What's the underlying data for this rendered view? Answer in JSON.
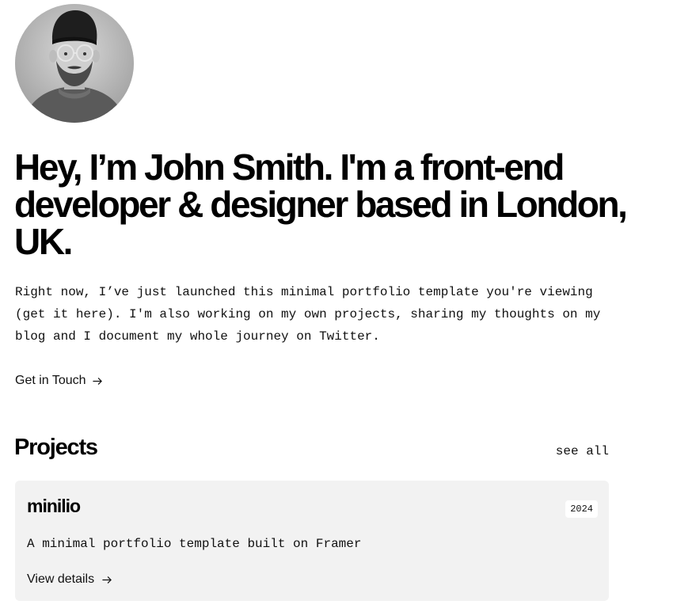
{
  "profile": {
    "avatar_alt": "Portrait of John Smith"
  },
  "hero": {
    "headline": "Hey, I’m John Smith. I'm a front-end developer & designer based in London, UK.",
    "intro": "Right now, I’ve just launched this minimal portfolio template you're viewing (get it here). I'm also working on my own projects, sharing my thoughts on my blog and I document my whole journey on Twitter.",
    "cta_label": "Get in Touch",
    "cta_icon": "arrow-right-icon"
  },
  "projects": {
    "title": "Projects",
    "see_all_label": "see all",
    "items": [
      {
        "name": "minilio",
        "year": "2024",
        "description": "A minimal portfolio template built on Framer",
        "link_label": "View details",
        "link_icon": "arrow-right-icon"
      }
    ]
  },
  "colors": {
    "text": "#111111",
    "heading": "#000000",
    "card_background": "#f2f2f2",
    "page_background": "#ffffff"
  }
}
